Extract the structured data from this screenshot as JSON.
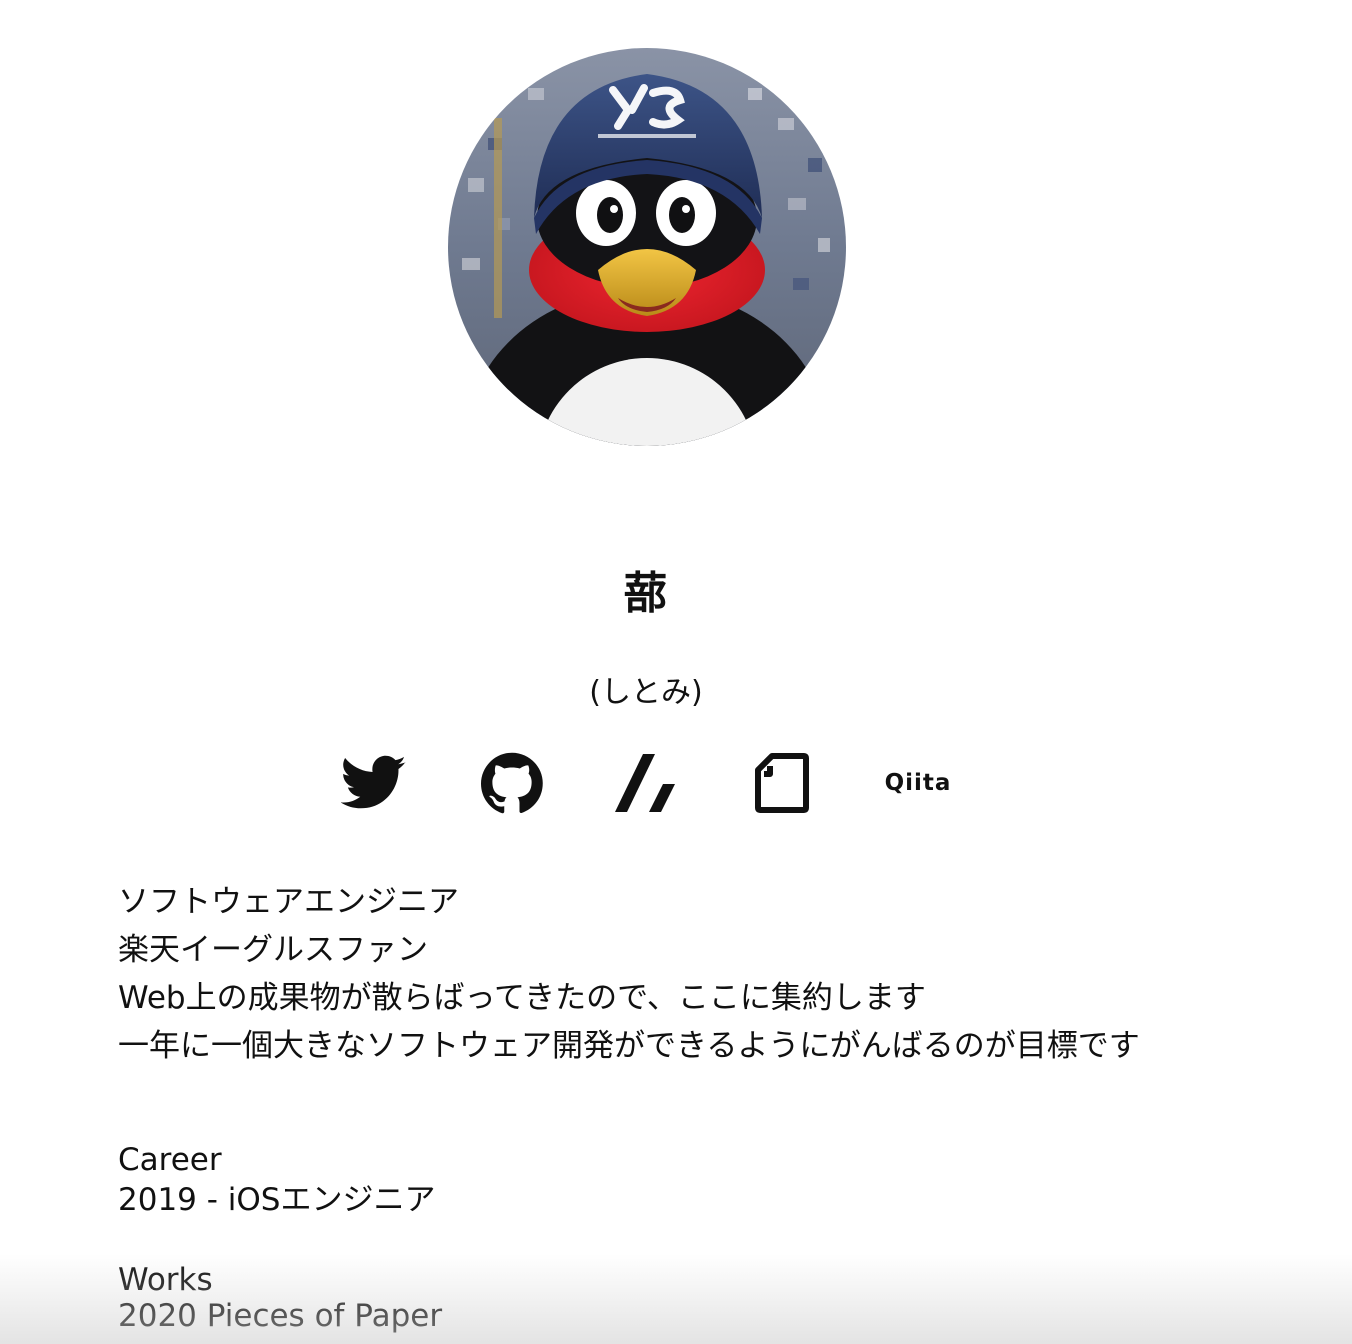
{
  "profile": {
    "name": "蔀",
    "reading": "(しとみ)"
  },
  "social_links": {
    "twitter": "twitter-icon",
    "github": "github-icon",
    "zenn": "zenn-icon",
    "note": "note-icon",
    "qiita_label": "Qiita"
  },
  "bio": {
    "lines": [
      "ソフトウェアエンジニア",
      "楽天イーグルスファン",
      "Web上の成果物が散らばってきたので、ここに集約します",
      "一年に一個大きなソフトウェア開発ができるようにがんばるのが目標です"
    ]
  },
  "career": {
    "heading": "Career",
    "items": [
      "2019 - iOSエンジニア"
    ]
  },
  "works": {
    "heading": "Works",
    "items": [
      "2020 Pieces of Paper"
    ]
  },
  "colors": {
    "text": "#111111",
    "background": "#ffffff"
  }
}
